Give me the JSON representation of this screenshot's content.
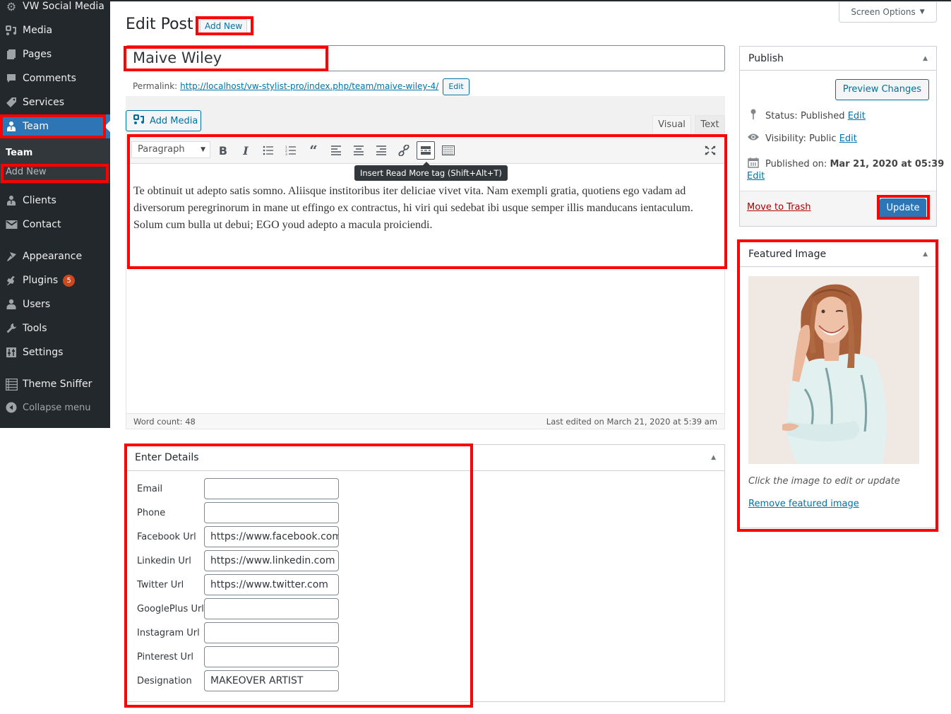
{
  "sidebar": {
    "items": [
      {
        "label": "VW Social Media",
        "icon": "gear-icon"
      },
      {
        "label": "Media",
        "icon": "media-icon"
      },
      {
        "label": "Pages",
        "icon": "pages-icon"
      },
      {
        "label": "Comments",
        "icon": "comments-icon"
      },
      {
        "label": "Services",
        "icon": "tag-icon"
      },
      {
        "label": "Team",
        "icon": "team-icon"
      },
      {
        "label": "Clients",
        "icon": "clients-icon"
      },
      {
        "label": "Contact",
        "icon": "mail-icon"
      },
      {
        "label": "Appearance",
        "icon": "brush-icon"
      },
      {
        "label": "Plugins",
        "icon": "plug-icon",
        "badge": "5"
      },
      {
        "label": "Users",
        "icon": "user-icon"
      },
      {
        "label": "Tools",
        "icon": "wrench-icon"
      },
      {
        "label": "Settings",
        "icon": "sliders-icon"
      },
      {
        "label": "Theme Sniffer",
        "icon": "list-icon"
      }
    ],
    "submenu": {
      "heading": "Team",
      "item": "Add New"
    },
    "collapse_label": "Collapse menu"
  },
  "header": {
    "title": "Edit Post",
    "add_new": "Add New",
    "screen_options": "Screen Options"
  },
  "post": {
    "title": "Maive Wiley",
    "permalink_label": "Permalink:",
    "permalink_url": "http://localhost/vw-stylist-pro/index.php/team/maive-wiley-4/",
    "permalink_edit": "Edit"
  },
  "editor": {
    "add_media": "Add Media",
    "tab_visual": "Visual",
    "tab_text": "Text",
    "format": "Paragraph",
    "tooltip": "Insert Read More tag (Shift+Alt+T)",
    "content": "Te obtinuit ut adepto satis somno. Aliisque institoribus iter deliciae vivet vita. Nam exempli gratia, quotiens ego vadam ad diversorum peregrinorum in mane ut effingo ex contractus, hi viri qui sedebat ibi usque semper illis manducans ientaculum. Solum cum bulla ut debui; EGO youd adepto a macula proiciendi.",
    "word_count": "Word count: 48",
    "last_edited": "Last edited on March 21, 2020 at 5:39 am"
  },
  "details": {
    "title": "Enter Details",
    "fields": [
      {
        "label": "Email",
        "value": ""
      },
      {
        "label": "Phone",
        "value": ""
      },
      {
        "label": "Facebook Url",
        "value": "https://www.facebook.com"
      },
      {
        "label": "Linkedin Url",
        "value": "https://www.linkedin.com"
      },
      {
        "label": "Twitter Url",
        "value": "https://www.twitter.com"
      },
      {
        "label": "GooglePlus Url",
        "value": ""
      },
      {
        "label": "Instagram Url",
        "value": ""
      },
      {
        "label": "Pinterest Url",
        "value": ""
      },
      {
        "label": "Designation",
        "value": "MAKEOVER ARTIST"
      }
    ]
  },
  "publish": {
    "title": "Publish",
    "preview": "Preview Changes",
    "status_label": "Status:",
    "status_value": "Published",
    "visibility_label": "Visibility:",
    "visibility_value": "Public",
    "published_label": "Published on:",
    "published_value": "Mar 21, 2020 at 05:39",
    "edit": "Edit",
    "trash": "Move to Trash",
    "update": "Update"
  },
  "featured": {
    "title": "Featured Image",
    "caption": "Click the image to edit or update",
    "remove": "Remove featured image"
  },
  "colors": {
    "sidebar_bg": "#23282d",
    "active": "#2e75b5",
    "link": "#0073aa",
    "highlight": "#ff0000",
    "badge": "#ca4a1f"
  }
}
